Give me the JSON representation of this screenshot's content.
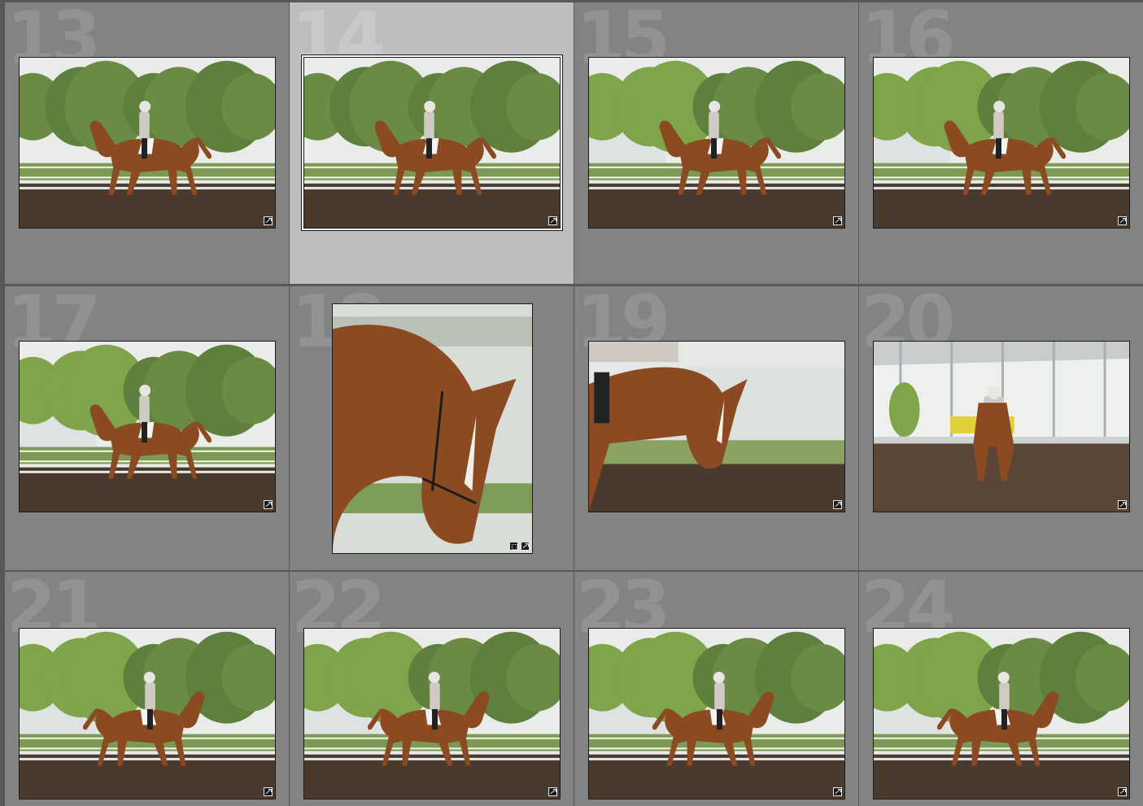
{
  "grid": {
    "cells": [
      {
        "index": "13",
        "scene": "arena-trees-trot",
        "selected": false,
        "badges": [
          "develop-settings-icon"
        ]
      },
      {
        "index": "14",
        "scene": "arena-trees-trot",
        "selected": true,
        "badges": [
          "develop-settings-icon"
        ]
      },
      {
        "index": "15",
        "scene": "arena-birch-walk",
        "selected": false,
        "badges": [
          "develop-settings-icon"
        ]
      },
      {
        "index": "16",
        "scene": "arena-birch-walk",
        "selected": false,
        "badges": [
          "develop-settings-icon"
        ]
      },
      {
        "index": "17",
        "scene": "arena-birch-walk",
        "selected": false,
        "badges": [
          "develop-settings-icon"
        ]
      },
      {
        "index": "18",
        "scene": "horse-head-closeup",
        "selected": false,
        "badges": [
          "crop-icon",
          "develop-settings-icon"
        ]
      },
      {
        "index": "19",
        "scene": "horse-neck-closeup",
        "selected": false,
        "badges": [
          "develop-settings-icon"
        ]
      },
      {
        "index": "20",
        "scene": "covered-arena-front",
        "selected": false,
        "badges": [
          "develop-settings-icon"
        ]
      },
      {
        "index": "21",
        "scene": "arena-birch-trot-right",
        "selected": false,
        "badges": [
          "develop-settings-icon"
        ]
      },
      {
        "index": "22",
        "scene": "arena-birch-trot-right",
        "selected": false,
        "badges": [
          "develop-settings-icon"
        ]
      },
      {
        "index": "23",
        "scene": "arena-birch-trot-right",
        "selected": false,
        "badges": [
          "develop-settings-icon"
        ]
      },
      {
        "index": "24",
        "scene": "arena-birch-trot-right",
        "selected": false,
        "badges": [
          "develop-settings-icon"
        ]
      }
    ]
  },
  "colors": {
    "cell_bg": "#838383",
    "cell_selected_bg": "#bdbdbd",
    "grid_gap": "#585858",
    "index_text": "#929292",
    "horse": "#8b4a22",
    "sky": "#e9ece8",
    "foliage": "#6d8f45",
    "dirt": "#4a3a2d"
  }
}
